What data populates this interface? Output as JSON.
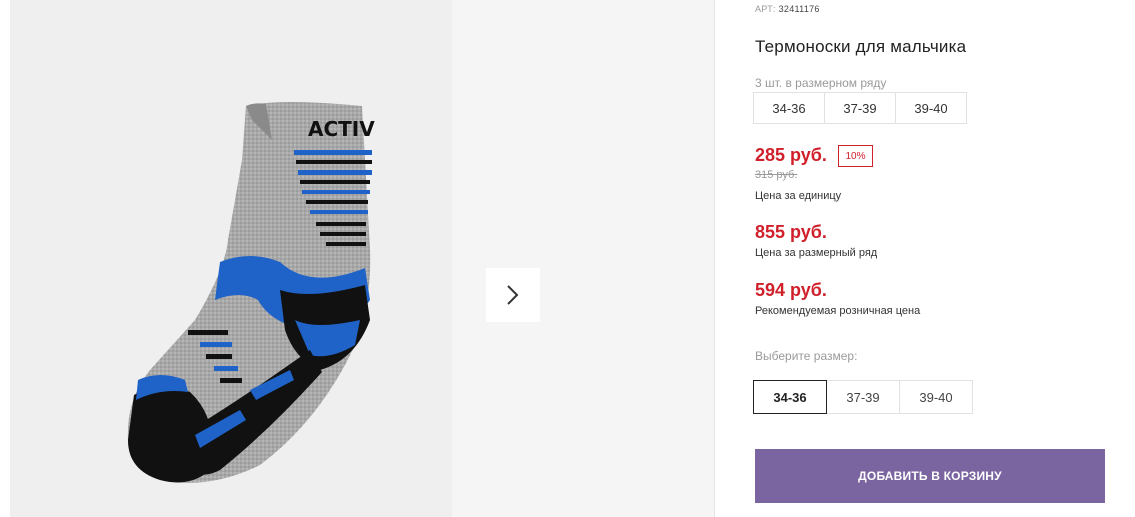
{
  "product": {
    "article_label": "АРТ:",
    "article_value": "32411176",
    "title": "Термоноски для мальчика",
    "image_text": "ACTIV"
  },
  "size_row": {
    "label": "3 шт. в размерном ряду",
    "sizes": [
      "34-36",
      "37-39",
      "39-40"
    ]
  },
  "pricing": {
    "unit_price": "285 руб.",
    "discount_badge": "10%",
    "old_price": "315 руб.",
    "unit_caption": "Цена за единицу",
    "row_price": "855 руб.",
    "row_caption": "Цена за размерный ряд",
    "retail_price": "594 руб.",
    "retail_caption": "Рекомендуемая розничная цена"
  },
  "size_select": {
    "label": "Выберите размер:",
    "options": [
      "34-36",
      "37-39",
      "39-40"
    ],
    "selected": "34-36"
  },
  "actions": {
    "add_to_cart": "ДОБАВИТЬ В КОРЗИНУ"
  },
  "gallery": {
    "next_icon": "chevron-right-icon"
  },
  "colors": {
    "price_red": "#d0202b",
    "button_purple": "#7b65a0",
    "sock_grey": "#a9a9a9",
    "sock_blue": "#1f63c8",
    "sock_black": "#111111"
  }
}
